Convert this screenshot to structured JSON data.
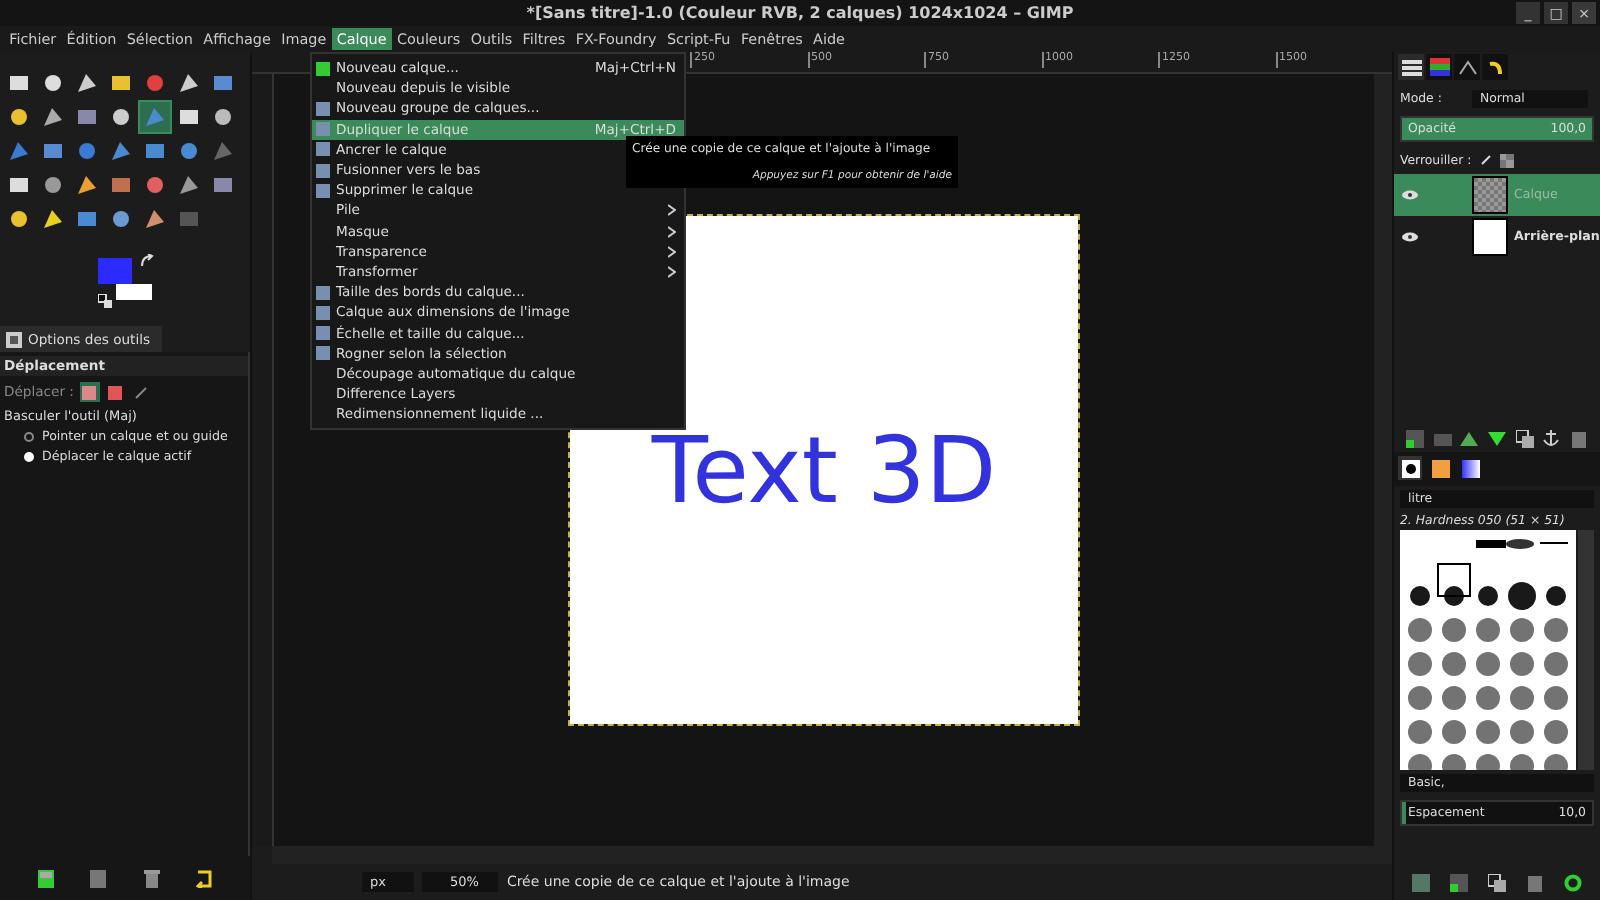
{
  "window": {
    "title": "*[Sans titre]-1.0 (Couleur RVB, 2 calques) 1024x1024 – GIMP",
    "controls": [
      "_",
      "□",
      "×"
    ]
  },
  "menubar": [
    {
      "label": "Fichier",
      "selected": false
    },
    {
      "label": "Édition",
      "selected": false
    },
    {
      "label": "Sélection",
      "selected": false
    },
    {
      "label": "Affichage",
      "selected": false
    },
    {
      "label": "Image",
      "selected": false
    },
    {
      "label": "Calque",
      "selected": true
    },
    {
      "label": "Couleurs",
      "selected": false
    },
    {
      "label": "Outils",
      "selected": false
    },
    {
      "label": "Filtres",
      "selected": false
    },
    {
      "label": "FX-Foundry",
      "selected": false
    },
    {
      "label": "Script-Fu",
      "selected": false
    },
    {
      "label": "Fenêtres",
      "selected": false
    },
    {
      "label": "Aide",
      "selected": false
    }
  ],
  "menu": [
    {
      "label": "Nouveau calque...",
      "shortcut": "Maj+Ctrl+N",
      "icon": true,
      "submenu": false,
      "selected": false
    },
    {
      "label": "Nouveau depuis le visible",
      "icon": false,
      "submenu": false,
      "selected": false
    },
    {
      "label": "Nouveau groupe de calques...",
      "icon": true,
      "submenu": false,
      "selected": false
    },
    {
      "label": "Dupliquer le calque",
      "shortcut": "Maj+Ctrl+D",
      "icon": true,
      "submenu": false,
      "selected": true
    },
    {
      "label": "Ancrer le calque",
      "icon": true,
      "submenu": false,
      "selected": false
    },
    {
      "label": "Fusionner vers le bas",
      "icon": true,
      "submenu": false,
      "selected": false
    },
    {
      "label": "Supprimer le calque",
      "icon": true,
      "submenu": false,
      "selected": false
    },
    {
      "label": "Pile",
      "icon": false,
      "submenu": true,
      "selected": false
    },
    {
      "label": "Masque",
      "icon": false,
      "submenu": true,
      "selected": false
    },
    {
      "label": "Transparence",
      "icon": false,
      "submenu": true,
      "selected": false
    },
    {
      "label": "Transformer",
      "icon": false,
      "submenu": true,
      "selected": false
    },
    {
      "label": "Taille des bords du calque...",
      "icon": true,
      "submenu": false,
      "selected": false
    },
    {
      "label": "Calque aux dimensions de l'image",
      "icon": true,
      "submenu": false,
      "selected": false
    },
    {
      "label": "Échelle et taille du calque...",
      "icon": true,
      "submenu": false,
      "selected": false
    },
    {
      "label": "Rogner selon la sélection",
      "icon": true,
      "submenu": false,
      "selected": false
    },
    {
      "label": "Découpage automatique du calque",
      "icon": false,
      "submenu": false,
      "selected": false
    },
    {
      "label": "Difference Layers",
      "icon": false,
      "submenu": false,
      "selected": false
    },
    {
      "label": "Redimensionnement liquide ...",
      "icon": false,
      "submenu": false,
      "selected": false
    }
  ],
  "tooltip": {
    "text": "Crée une copie de ce calque et l'ajoute à l'image",
    "hint": "Appuyez sur F1 pour obtenir de l'aide"
  },
  "ruler": [
    "250",
    "500",
    "750",
    "1000",
    "1250",
    "1500"
  ],
  "tools": [
    {
      "selected": false
    },
    {
      "selected": false
    },
    {
      "selected": false
    },
    {
      "selected": false
    },
    {
      "selected": false
    },
    {
      "selected": false
    },
    {
      "selected": false
    },
    {
      "selected": false
    },
    {
      "selected": false
    },
    {
      "selected": false
    },
    {
      "selected": false
    },
    {
      "selected": true
    },
    {
      "selected": false
    },
    {
      "selected": false
    },
    {
      "selected": false
    },
    {
      "selected": false
    },
    {
      "selected": false
    },
    {
      "selected": false
    },
    {
      "selected": false
    },
    {
      "selected": false
    },
    {
      "selected": false
    },
    {
      "selected": false
    },
    {
      "selected": false
    },
    {
      "selected": false
    },
    {
      "selected": false
    },
    {
      "selected": false
    },
    {
      "selected": false
    },
    {
      "selected": false
    },
    {
      "selected": false
    },
    {
      "selected": false
    },
    {
      "selected": false
    },
    {
      "selected": false
    },
    {
      "selected": false
    },
    {
      "selected": false
    }
  ],
  "tool_options": {
    "tab": "Options des outils",
    "title": "Déplacement",
    "move_label": "Déplacer :",
    "move_modes": [
      {
        "selected": true
      },
      {
        "selected": false
      },
      {
        "selected": false
      }
    ],
    "toggle": "Basculer l'outil  (Maj)",
    "options": [
      {
        "label": "Pointer un calque et ou guide",
        "selected": false
      },
      {
        "label": "Déplacer le calque actif",
        "selected": true
      }
    ]
  },
  "canvas": {
    "text": "Text 3D"
  },
  "status": {
    "unit": "px",
    "zoom": "50%",
    "message": "Crée une copie de ce calque et l'ajoute à l'image"
  },
  "layers_panel": {
    "mode_label": "Mode :",
    "mode": "Normal",
    "opacity_label": "Opacité",
    "opacity": "100,0",
    "level": 1.0,
    "lock_label": "Verrouiller :",
    "layers": [
      {
        "name": "Calque",
        "selected": true,
        "visible": true
      },
      {
        "name": "Arrière-plan",
        "selected": false,
        "visible": true
      }
    ]
  },
  "brushes_panel": {
    "filter": "litre",
    "brush": "2. Hardness 050 (51 × 51)",
    "preset": "Basic,",
    "spacing_label": "Espacement",
    "spacing": "10,0",
    "level": 0.02
  }
}
